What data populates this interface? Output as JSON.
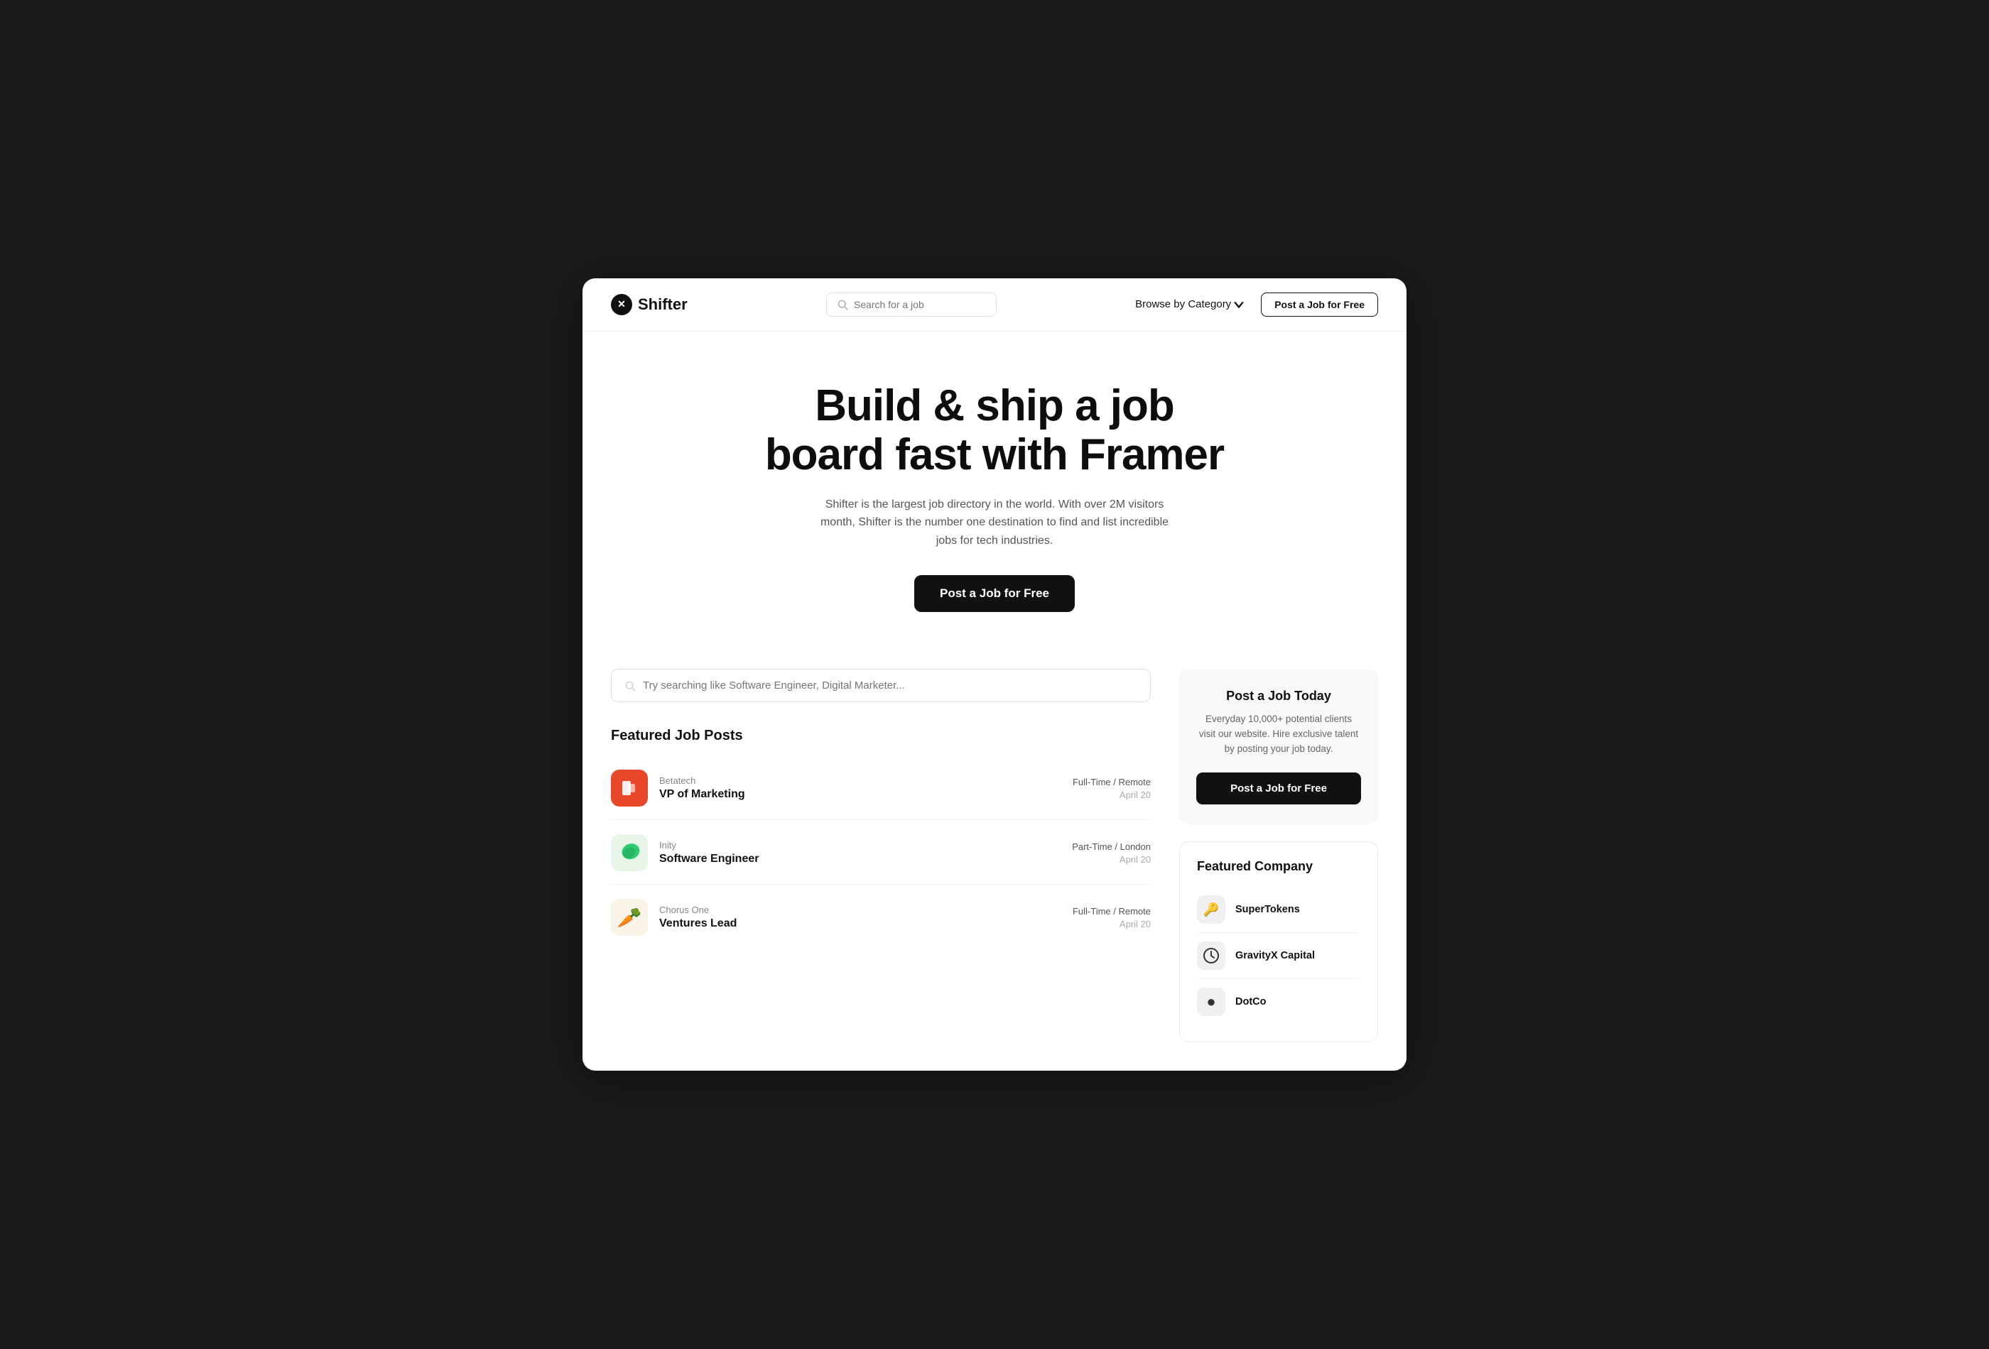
{
  "meta": {
    "page_bg": "#1a1a1a",
    "card_bg": "#ffffff"
  },
  "navbar": {
    "logo_text": "Shifter",
    "search_placeholder": "Search for a job",
    "browse_label": "Browse by Category",
    "post_button_label": "Post a Job for Free"
  },
  "hero": {
    "headline_line1": "Build & ship a job",
    "headline_line2": "board fast with Framer",
    "subtitle": "Shifter is the largest job directory in the world. With over 2M visitors month, Shifter is the number one destination to find and list incredible jobs for tech industries.",
    "cta_label": "Post a Job for Free"
  },
  "search": {
    "placeholder": "Try searching like Software Engineer, Digital Marketer..."
  },
  "featured_jobs": {
    "section_title": "Featured Job Posts",
    "jobs": [
      {
        "company": "Betatech",
        "title": "VP of Marketing",
        "type": "Full-Time / Remote",
        "date": "April 20",
        "logo_type": "betatech",
        "logo_letter": "b"
      },
      {
        "company": "Inity",
        "title": "Software Engineer",
        "type": "Part-Time / London",
        "date": "April 20",
        "logo_type": "inity",
        "logo_letter": "🍃"
      },
      {
        "company": "Chorus One",
        "title": "Ventures Lead",
        "type": "Full-Time / Remote",
        "date": "April 20",
        "logo_type": "chorus",
        "logo_letter": "🥕"
      }
    ]
  },
  "sidebar": {
    "post_card": {
      "title": "Post a Job Today",
      "description": "Everyday 10,000+ potential clients visit our website. Hire exclusive talent by posting your job today.",
      "button_label": "Post a Job for Free"
    },
    "featured_company": {
      "title": "Featured Company",
      "companies": [
        {
          "name": "SuperTokens",
          "icon": "🔑",
          "bg": "#f5f5f5"
        },
        {
          "name": "GravityX Capital",
          "icon": "⏰",
          "bg": "#f5f5f5"
        },
        {
          "name": "DotCo",
          "icon": "●",
          "bg": "#f5f5f5"
        }
      ]
    }
  }
}
